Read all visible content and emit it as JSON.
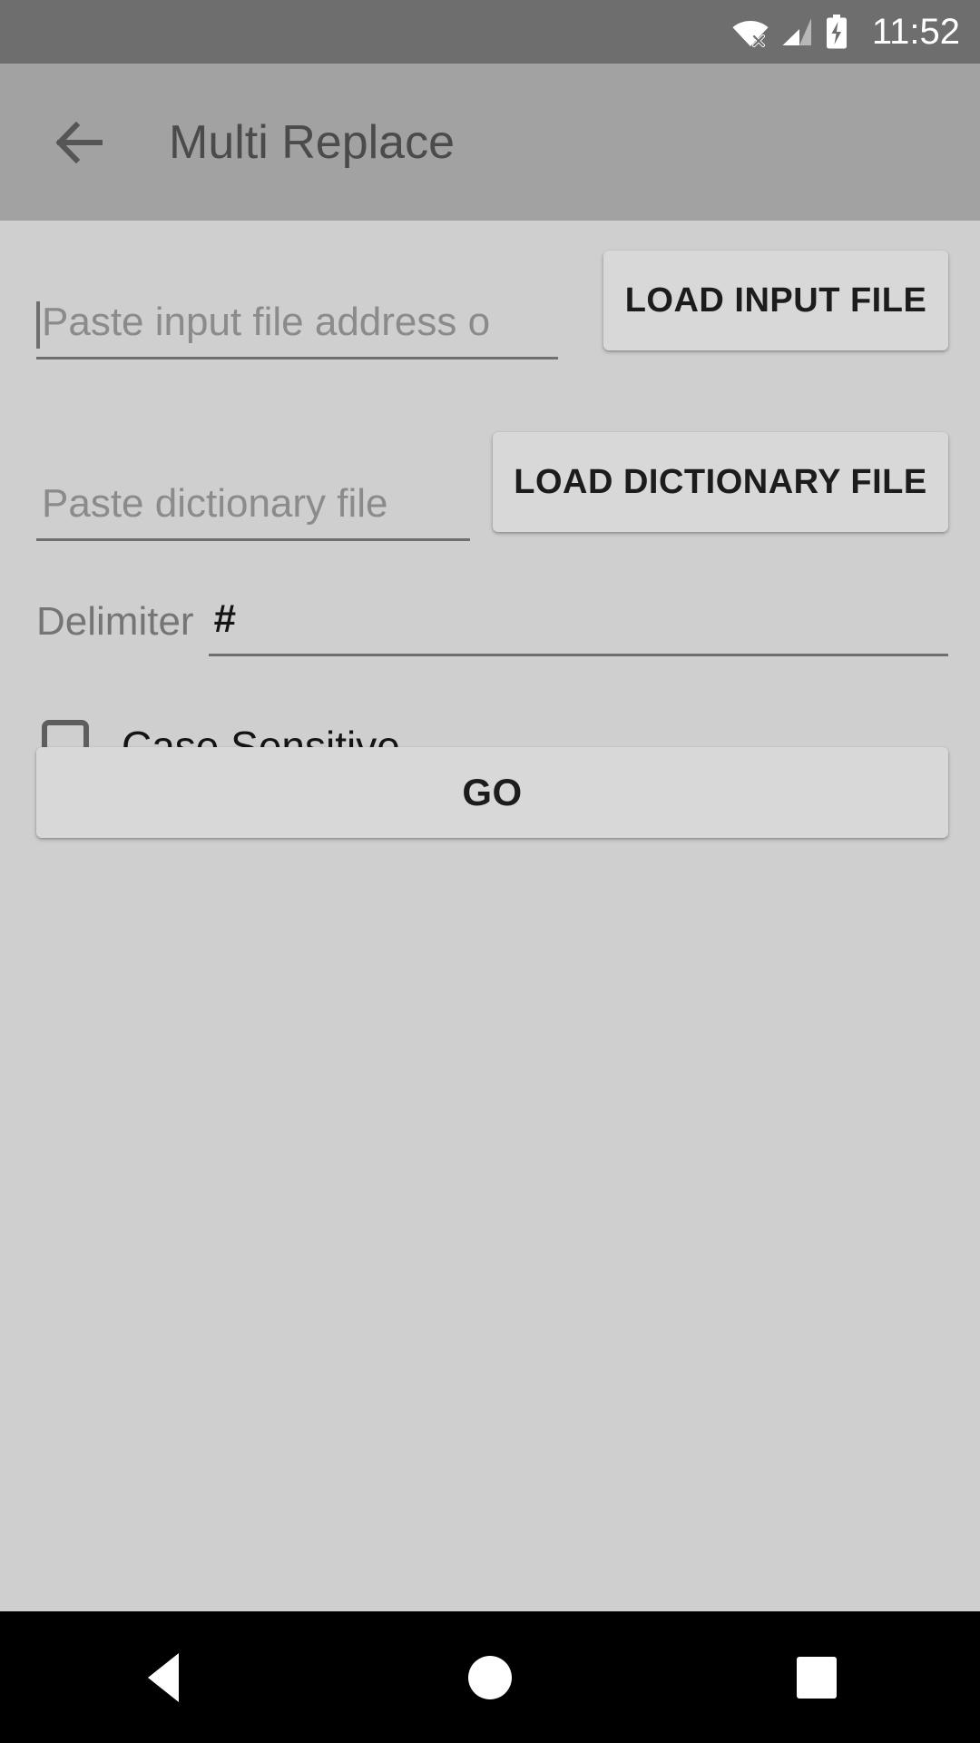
{
  "status_bar": {
    "time": "11:52",
    "icons": [
      "wifi-no-internet-icon",
      "cellular-signal-icon",
      "battery-charging-icon"
    ]
  },
  "toolbar": {
    "back_icon": "back-arrow-icon",
    "title": "Multi Replace"
  },
  "form": {
    "input_file": {
      "placeholder": "Paste input file address o",
      "value": "",
      "button_label": "LOAD INPUT FILE"
    },
    "dictionary_file": {
      "placeholder": "Paste dictionary file",
      "value": "",
      "button_label": "LOAD DICTIONARY FILE"
    },
    "delimiter": {
      "label": "Delimiter",
      "value": "#",
      "placeholder": ""
    },
    "case_sensitive": {
      "label": "Case Sensitive",
      "checked": false
    },
    "submit": {
      "label": "GO"
    }
  },
  "nav_bar": {
    "back_label": "back-triangle-icon",
    "home_label": "home-circle-icon",
    "recents_label": "recents-square-icon"
  },
  "colors": {
    "status_bar_bg": "#6e6e6e",
    "toolbar_bg": "#a2a2a2",
    "content_bg": "#cfcfcf",
    "button_bg": "#d8d8d8",
    "nav_bar_bg": "#000000",
    "text_primary": "#141414",
    "text_hint": "#8b8b8b",
    "underline": "#6f6f6f"
  }
}
